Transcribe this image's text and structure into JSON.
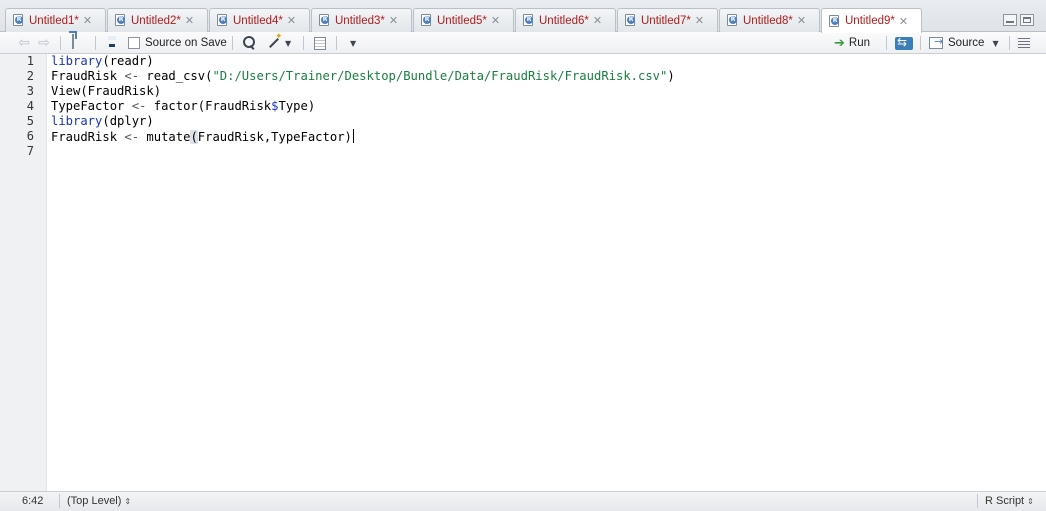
{
  "tabs": [
    {
      "label": "Untitled1*",
      "active": false
    },
    {
      "label": "Untitled2*",
      "active": false
    },
    {
      "label": "Untitled4*",
      "active": false
    },
    {
      "label": "Untitled3*",
      "active": false
    },
    {
      "label": "Untitled5*",
      "active": false
    },
    {
      "label": "Untitled6*",
      "active": false
    },
    {
      "label": "Untitled7*",
      "active": false
    },
    {
      "label": "Untitled8*",
      "active": false
    },
    {
      "label": "Untitled9*",
      "active": true
    }
  ],
  "toolbar": {
    "source_on_save_label": "Source on Save",
    "source_on_save_checked": false,
    "run_label": "Run",
    "source_label": "Source"
  },
  "editor": {
    "line_numbers": [
      "1",
      "2",
      "3",
      "4",
      "5",
      "6",
      "7"
    ],
    "lines": {
      "l1_fn": "library",
      "l1_rest": "(readr)",
      "l2_a": "FraudRisk ",
      "l2_op": "<-",
      "l2_b": " read_csv(",
      "l2_str": "\"D:/Users/Trainer/Desktop/Bundle/Data/FraudRisk/FraudRisk.csv\"",
      "l2_c": ")",
      "l3": "View(FraudRisk)",
      "l4_a": "TypeFactor ",
      "l4_op": "<-",
      "l4_b": " factor(FraudRisk",
      "l4_dollar": "$",
      "l4_c": "Type)",
      "l5_fn": "library",
      "l5_rest": "(dplyr)",
      "l6_a": "FraudRisk ",
      "l6_op": "<-",
      "l6_b": " mutate",
      "l6_paren": "(",
      "l6_c": "FraudRisk,TypeFactor)"
    }
  },
  "status": {
    "cursor_position": "6:42",
    "scope": "(Top Level)",
    "file_type": "R Script"
  },
  "colors": {
    "tab_label": "#b01c1c",
    "keyword": "#1a36b8",
    "string": "#19803c"
  }
}
